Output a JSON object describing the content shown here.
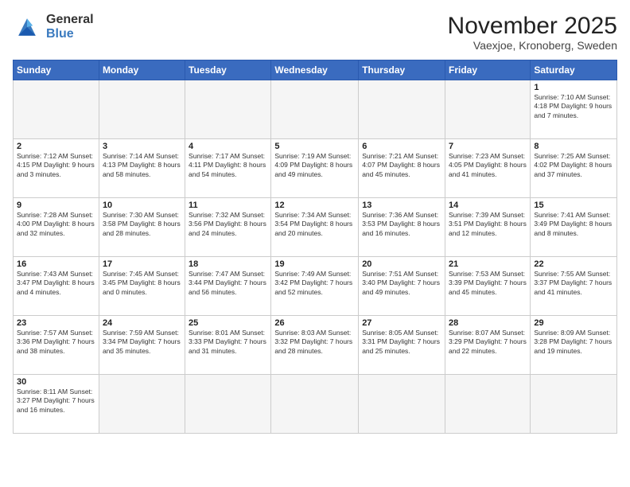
{
  "logo": {
    "line1": "General",
    "line2": "Blue"
  },
  "title": "November 2025",
  "subtitle": "Vaexjoe, Kronoberg, Sweden",
  "days_of_week": [
    "Sunday",
    "Monday",
    "Tuesday",
    "Wednesday",
    "Thursday",
    "Friday",
    "Saturday"
  ],
  "weeks": [
    [
      {
        "day": "",
        "info": "",
        "empty": true
      },
      {
        "day": "",
        "info": "",
        "empty": true
      },
      {
        "day": "",
        "info": "",
        "empty": true
      },
      {
        "day": "",
        "info": "",
        "empty": true
      },
      {
        "day": "",
        "info": "",
        "empty": true
      },
      {
        "day": "",
        "info": "",
        "empty": true
      },
      {
        "day": "1",
        "info": "Sunrise: 7:10 AM\nSunset: 4:18 PM\nDaylight: 9 hours\nand 7 minutes."
      }
    ],
    [
      {
        "day": "2",
        "info": "Sunrise: 7:12 AM\nSunset: 4:15 PM\nDaylight: 9 hours\nand 3 minutes."
      },
      {
        "day": "3",
        "info": "Sunrise: 7:14 AM\nSunset: 4:13 PM\nDaylight: 8 hours\nand 58 minutes."
      },
      {
        "day": "4",
        "info": "Sunrise: 7:17 AM\nSunset: 4:11 PM\nDaylight: 8 hours\nand 54 minutes."
      },
      {
        "day": "5",
        "info": "Sunrise: 7:19 AM\nSunset: 4:09 PM\nDaylight: 8 hours\nand 49 minutes."
      },
      {
        "day": "6",
        "info": "Sunrise: 7:21 AM\nSunset: 4:07 PM\nDaylight: 8 hours\nand 45 minutes."
      },
      {
        "day": "7",
        "info": "Sunrise: 7:23 AM\nSunset: 4:05 PM\nDaylight: 8 hours\nand 41 minutes."
      },
      {
        "day": "8",
        "info": "Sunrise: 7:25 AM\nSunset: 4:02 PM\nDaylight: 8 hours\nand 37 minutes."
      }
    ],
    [
      {
        "day": "9",
        "info": "Sunrise: 7:28 AM\nSunset: 4:00 PM\nDaylight: 8 hours\nand 32 minutes."
      },
      {
        "day": "10",
        "info": "Sunrise: 7:30 AM\nSunset: 3:58 PM\nDaylight: 8 hours\nand 28 minutes."
      },
      {
        "day": "11",
        "info": "Sunrise: 7:32 AM\nSunset: 3:56 PM\nDaylight: 8 hours\nand 24 minutes."
      },
      {
        "day": "12",
        "info": "Sunrise: 7:34 AM\nSunset: 3:54 PM\nDaylight: 8 hours\nand 20 minutes."
      },
      {
        "day": "13",
        "info": "Sunrise: 7:36 AM\nSunset: 3:53 PM\nDaylight: 8 hours\nand 16 minutes."
      },
      {
        "day": "14",
        "info": "Sunrise: 7:39 AM\nSunset: 3:51 PM\nDaylight: 8 hours\nand 12 minutes."
      },
      {
        "day": "15",
        "info": "Sunrise: 7:41 AM\nSunset: 3:49 PM\nDaylight: 8 hours\nand 8 minutes."
      }
    ],
    [
      {
        "day": "16",
        "info": "Sunrise: 7:43 AM\nSunset: 3:47 PM\nDaylight: 8 hours\nand 4 minutes."
      },
      {
        "day": "17",
        "info": "Sunrise: 7:45 AM\nSunset: 3:45 PM\nDaylight: 8 hours\nand 0 minutes."
      },
      {
        "day": "18",
        "info": "Sunrise: 7:47 AM\nSunset: 3:44 PM\nDaylight: 7 hours\nand 56 minutes."
      },
      {
        "day": "19",
        "info": "Sunrise: 7:49 AM\nSunset: 3:42 PM\nDaylight: 7 hours\nand 52 minutes."
      },
      {
        "day": "20",
        "info": "Sunrise: 7:51 AM\nSunset: 3:40 PM\nDaylight: 7 hours\nand 49 minutes."
      },
      {
        "day": "21",
        "info": "Sunrise: 7:53 AM\nSunset: 3:39 PM\nDaylight: 7 hours\nand 45 minutes."
      },
      {
        "day": "22",
        "info": "Sunrise: 7:55 AM\nSunset: 3:37 PM\nDaylight: 7 hours\nand 41 minutes."
      }
    ],
    [
      {
        "day": "23",
        "info": "Sunrise: 7:57 AM\nSunset: 3:36 PM\nDaylight: 7 hours\nand 38 minutes."
      },
      {
        "day": "24",
        "info": "Sunrise: 7:59 AM\nSunset: 3:34 PM\nDaylight: 7 hours\nand 35 minutes."
      },
      {
        "day": "25",
        "info": "Sunrise: 8:01 AM\nSunset: 3:33 PM\nDaylight: 7 hours\nand 31 minutes."
      },
      {
        "day": "26",
        "info": "Sunrise: 8:03 AM\nSunset: 3:32 PM\nDaylight: 7 hours\nand 28 minutes."
      },
      {
        "day": "27",
        "info": "Sunrise: 8:05 AM\nSunset: 3:31 PM\nDaylight: 7 hours\nand 25 minutes."
      },
      {
        "day": "28",
        "info": "Sunrise: 8:07 AM\nSunset: 3:29 PM\nDaylight: 7 hours\nand 22 minutes."
      },
      {
        "day": "29",
        "info": "Sunrise: 8:09 AM\nSunset: 3:28 PM\nDaylight: 7 hours\nand 19 minutes."
      }
    ],
    [
      {
        "day": "30",
        "info": "Sunrise: 8:11 AM\nSunset: 3:27 PM\nDaylight: 7 hours\nand 16 minutes."
      },
      {
        "day": "",
        "info": "",
        "empty": true
      },
      {
        "day": "",
        "info": "",
        "empty": true
      },
      {
        "day": "",
        "info": "",
        "empty": true
      },
      {
        "day": "",
        "info": "",
        "empty": true
      },
      {
        "day": "",
        "info": "",
        "empty": true
      },
      {
        "day": "",
        "info": "",
        "empty": true
      }
    ]
  ]
}
